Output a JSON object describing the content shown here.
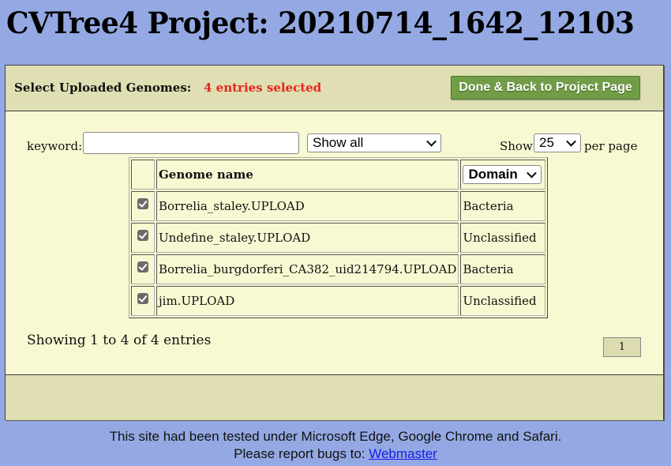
{
  "page": {
    "title": "CVTree4 Project: 20210714_1642_12103"
  },
  "header": {
    "label": "Select Uploaded Genomes:",
    "selected_count": "4 entries selected",
    "done_button": "Done & Back to Project Page"
  },
  "filters": {
    "keyword_label": "keyword:",
    "keyword_value": "",
    "keyword_placeholder": "",
    "show_filter_selected": "Show all",
    "show_label": "Show",
    "per_page_selected": "25",
    "per_page_label": "per page"
  },
  "table": {
    "columns": {
      "check": "",
      "name": "Genome name",
      "domain_select": "Domain"
    },
    "rows": [
      {
        "checked": true,
        "name": "Borrelia_staley.UPLOAD",
        "domain": "Bacteria"
      },
      {
        "checked": true,
        "name": "Undefine_staley.UPLOAD",
        "domain": "Unclassified"
      },
      {
        "checked": true,
        "name": "Borrelia_burgdorferi_CA382_uid214794.UPLOAD",
        "domain": "Bacteria"
      },
      {
        "checked": true,
        "name": "jim.UPLOAD",
        "domain": "Unclassified"
      }
    ]
  },
  "pagination": {
    "showing_text": "Showing 1 to 4 of 4 entries",
    "pages": [
      "1"
    ]
  },
  "footer": {
    "line1": "This site had been tested under Microsoft Edge, Google Chrome and Safari.",
    "line2_prefix": "Please report bugs to: ",
    "webmaster_link": "Webmaster"
  },
  "colors": {
    "page_background": "#94a9e3",
    "panel_background": "#f8f9d2",
    "header_background": "#dfdfb3",
    "selected_count": "#e8241a",
    "done_button": "#6e9a44",
    "link": "#1a1ae6"
  }
}
